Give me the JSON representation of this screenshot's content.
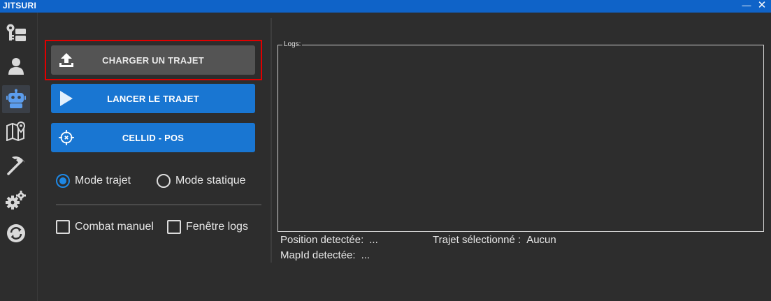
{
  "window": {
    "title": "JITSURI",
    "minimize_label": "—",
    "close_label": "✕"
  },
  "sidebar": {
    "items": [
      {
        "name": "keys",
        "icon": "key-icon",
        "active": false
      },
      {
        "name": "account",
        "icon": "user-icon",
        "active": false
      },
      {
        "name": "bot",
        "icon": "robot-icon",
        "active": true
      },
      {
        "name": "map",
        "icon": "map-icon",
        "active": false
      },
      {
        "name": "harvest",
        "icon": "pickaxe-icon",
        "active": false
      },
      {
        "name": "settings",
        "icon": "gears-icon",
        "active": false
      },
      {
        "name": "sync",
        "icon": "refresh-icon",
        "active": false
      }
    ]
  },
  "actions": {
    "load_label": "CHARGER UN TRAJET",
    "start_label": "LANCER LE TRAJET",
    "cellid_label": "CELLID - POS"
  },
  "mode": {
    "trajet_label": "Mode trajet",
    "static_label": "Mode statique",
    "selected": "trajet"
  },
  "options": {
    "manual_combat_label": "Combat manuel",
    "manual_combat_checked": false,
    "logs_window_label": "Fenêtre logs",
    "logs_window_checked": false
  },
  "logs": {
    "legend": "Logs:"
  },
  "status": {
    "position_label": "Position detectée:",
    "position_value": "...",
    "path_label": "Trajet sélectionné :",
    "path_value": "Aucun",
    "mapid_label": "MapId detectée:",
    "mapid_value": "..."
  },
  "colors": {
    "titlebar": "#0f63c8",
    "primary_button": "#1976d2",
    "secondary_button": "#545454",
    "highlight": "#e00000",
    "background": "#2d2d2d"
  }
}
